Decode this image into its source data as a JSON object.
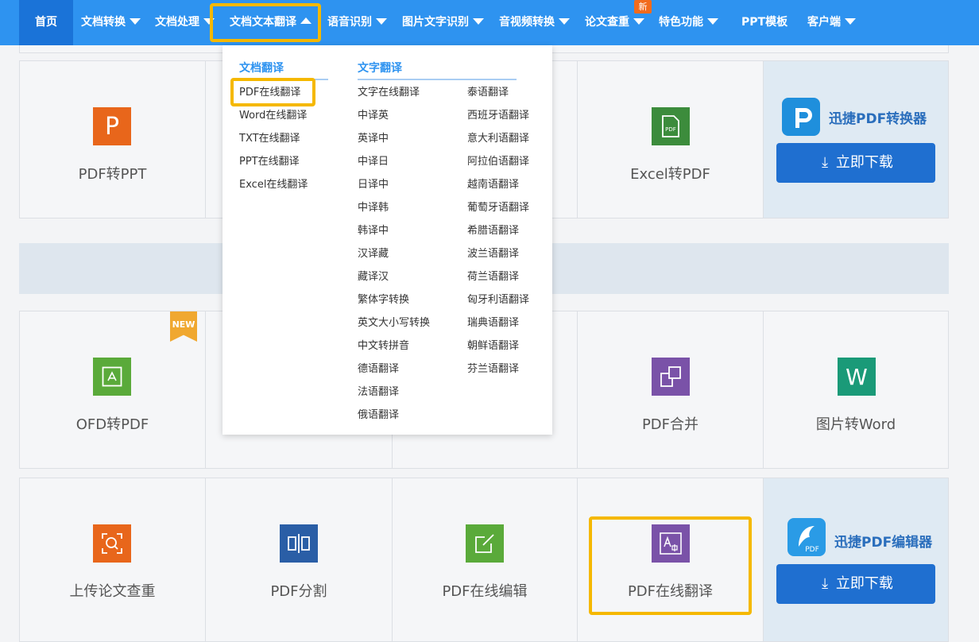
{
  "nav": {
    "items": [
      {
        "label": "首页"
      },
      {
        "label": "文档转换"
      },
      {
        "label": "文档处理"
      },
      {
        "label": "文档文本翻译"
      },
      {
        "label": "语音识别"
      },
      {
        "label": "图片文字识别"
      },
      {
        "label": "音视频转换"
      },
      {
        "label": "论文查重"
      },
      {
        "label": "特色功能"
      },
      {
        "label": "PPT模板"
      },
      {
        "label": "客户端"
      }
    ],
    "new_badge": "新"
  },
  "dropdown": {
    "doc_heading": "文档翻译",
    "doc_items": [
      "PDF在线翻译",
      "Word在线翻译",
      "TXT在线翻译",
      "PPT在线翻译",
      "Excel在线翻译"
    ],
    "text_heading": "文字翻译",
    "text_col1": [
      "文字在线翻译",
      "中译英",
      "英译中",
      "中译日",
      "日译中",
      "中译韩",
      "韩译中",
      "汉译藏",
      "藏译汉",
      "繁体字转换",
      "英文大小写转换",
      "中文转拼音",
      "德语翻译",
      "法语翻译",
      "俄语翻译"
    ],
    "text_col2": [
      "泰语翻译",
      "西班牙语翻译",
      "意大利语翻译",
      "阿拉伯语翻译",
      "越南语翻译",
      "葡萄牙语翻译",
      "希腊语翻译",
      "波兰语翻译",
      "荷兰语翻译",
      "匈牙利语翻译",
      "瑞典语翻译",
      "朝鲜语翻译",
      "芬兰语翻译"
    ]
  },
  "cards": {
    "pdf_to_ppt": "PDF转PPT",
    "excel_to_pdf": "Excel转PDF",
    "ofd_to_pdf": "OFD转PDF",
    "pdf_merge": "PDF合并",
    "img_to_word": "图片转Word",
    "upload_check": "上传论文查重",
    "pdf_split": "PDF分割",
    "pdf_edit": "PDF在线编辑",
    "pdf_translate": "PDF在线翻译",
    "new_tag": "NEW",
    "pdf_icon_text": "PDF",
    "ppt_icon_text": "P",
    "word_icon_text": "W"
  },
  "promo": {
    "converter_title": "迅捷PDF转换器",
    "editor_title": "迅捷PDF编辑器",
    "download_label": "立即下载",
    "editor_logo_text": "PDF"
  },
  "colors": {
    "nav_bg": "#2e93f0",
    "nav_active": "#1a73d8",
    "highlight": "#f5b800",
    "tile_orange": "#e8661b",
    "tile_green": "#3c8c3c",
    "tile_green_light": "#5aaa3a",
    "tile_purple": "#7a52a8",
    "tile_teal": "#1a9a78",
    "tile_blue": "#2a5ea6"
  }
}
